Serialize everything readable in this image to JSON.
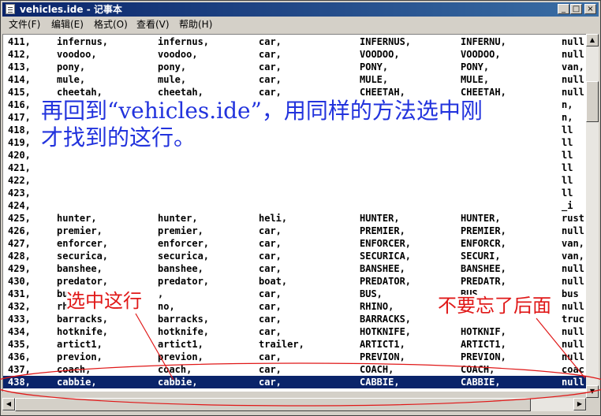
{
  "window": {
    "title": "vehicles.ide - 记事本",
    "controls": {
      "minimize": "_",
      "maximize": "□",
      "close": "×"
    }
  },
  "menu": [
    "文件(F)",
    "编辑(E)",
    "格式(O)",
    "查看(V)",
    "帮助(H)"
  ],
  "rows": [
    {
      "id": "411,",
      "c1": "infernus,",
      "c2": "infernus,",
      "c3": "car,",
      "c4": "INFERNUS,",
      "c5": "INFERNU,",
      "c6": "null"
    },
    {
      "id": "412,",
      "c1": "voodoo,",
      "c2": "voodoo,",
      "c3": "car,",
      "c4": "VOODOO,",
      "c5": "VOODOO,",
      "c6": "null"
    },
    {
      "id": "413,",
      "c1": "pony,",
      "c2": "pony,",
      "c3": "car,",
      "c4": "PONY,",
      "c5": "PONY,",
      "c6": "van,"
    },
    {
      "id": "414,",
      "c1": "mule,",
      "c2": "mule,",
      "c3": "car,",
      "c4": "MULE,",
      "c5": "MULE,",
      "c6": "null"
    },
    {
      "id": "415,",
      "c1": "cheetah,",
      "c2": "cheetah,",
      "c3": "car,",
      "c4": "CHEETAH,",
      "c5": "CHEETAH,",
      "c6": "null"
    },
    {
      "id": "416,",
      "c1": "",
      "c2": "",
      "c3": "",
      "c4": "",
      "c5": "",
      "c6": "n,"
    },
    {
      "id": "417,",
      "c1": "",
      "c2": "",
      "c3": "",
      "c4": "",
      "c5": "",
      "c6": "n,"
    },
    {
      "id": "418,",
      "c1": "",
      "c2": "",
      "c3": "",
      "c4": "",
      "c5": "",
      "c6": "ll"
    },
    {
      "id": "419,",
      "c1": "",
      "c2": "",
      "c3": "",
      "c4": "",
      "c5": "",
      "c6": "ll"
    },
    {
      "id": "420,",
      "c1": "",
      "c2": "",
      "c3": "",
      "c4": "",
      "c5": "",
      "c6": "ll"
    },
    {
      "id": "421,",
      "c1": "",
      "c2": "",
      "c3": "",
      "c4": "",
      "c5": "",
      "c6": "ll"
    },
    {
      "id": "422,",
      "c1": "",
      "c2": "",
      "c3": "",
      "c4": "",
      "c5": "",
      "c6": "ll"
    },
    {
      "id": "423,",
      "c1": "",
      "c2": "",
      "c3": "",
      "c4": "",
      "c5": "",
      "c6": "ll"
    },
    {
      "id": "424,",
      "c1": "",
      "c2": "",
      "c3": "",
      "c4": "",
      "c5": "",
      "c6": "_i"
    },
    {
      "id": "425,",
      "c1": "hunter,",
      "c2": "hunter,",
      "c3": "heli,",
      "c4": "HUNTER,",
      "c5": "HUNTER,",
      "c6": "rust"
    },
    {
      "id": "426,",
      "c1": "premier,",
      "c2": "premier,",
      "c3": "car,",
      "c4": "PREMIER,",
      "c5": "PREMIER,",
      "c6": "null"
    },
    {
      "id": "427,",
      "c1": "enforcer,",
      "c2": "enforcer,",
      "c3": "car,",
      "c4": "ENFORCER,",
      "c5": "ENFORCR,",
      "c6": "van,"
    },
    {
      "id": "428,",
      "c1": "securica,",
      "c2": "securica,",
      "c3": "car,",
      "c4": "SECURICA,",
      "c5": "SECURI,",
      "c6": "van,"
    },
    {
      "id": "429,",
      "c1": "banshee,",
      "c2": "banshee,",
      "c3": "car,",
      "c4": "BANSHEE,",
      "c5": "BANSHEE,",
      "c6": "null"
    },
    {
      "id": "430,",
      "c1": "predator,",
      "c2": "predator,",
      "c3": "boat,",
      "c4": "PREDATOR,",
      "c5": "PREDATR,",
      "c6": "null"
    },
    {
      "id": "431,",
      "c1": "bu",
      "c2": ",",
      "c3": "car,",
      "c4": "BUS,",
      "c5": "BUS,",
      "c6": "bus"
    },
    {
      "id": "432,",
      "c1": "rh",
      "c2": "no,",
      "c3": "car,",
      "c4": "RHINO,",
      "c5": "",
      "c6": "null"
    },
    {
      "id": "433,",
      "c1": "barracks,",
      "c2": "barracks,",
      "c3": "car,",
      "c4": "BARRACKS,",
      "c5": "",
      "c6": "truc"
    },
    {
      "id": "434,",
      "c1": "hotknife,",
      "c2": "hotknife,",
      "c3": "car,",
      "c4": "HOTKNIFE,",
      "c5": "HOTKNIF,",
      "c6": "null"
    },
    {
      "id": "435,",
      "c1": "artict1,",
      "c2": "artict1,",
      "c3": "trailer,",
      "c4": "ARTICT1,",
      "c5": "ARTICT1,",
      "c6": "null"
    },
    {
      "id": "436,",
      "c1": "previon,",
      "c2": "previon,",
      "c3": "car,",
      "c4": "PREVION,",
      "c5": "PREVION,",
      "c6": "null"
    },
    {
      "id": "437,",
      "c1": "coach,",
      "c2": "coach,",
      "c3": "car,",
      "c4": "COACH,",
      "c5": "COACH,",
      "c6": "coac"
    },
    {
      "id": "438,",
      "c1": "cabbie,",
      "c2": "cabbie,",
      "c3": "car,",
      "c4": "CABBIE,",
      "c5": "CABBIE,",
      "c6": "null",
      "selected": true
    }
  ],
  "annotations": {
    "main": [
      "再回到“vehicles.ide”，用同样的方法选中刚",
      "才找到的这行。"
    ],
    "select_row": "选中这行",
    "dont_forget": "不要忘了后面"
  },
  "colors": {
    "title_start": "#0a246a",
    "title_end": "#3a6ea5",
    "selection": "#0a246a",
    "annotation_blue": "#2233dd",
    "annotation_red": "#e01818"
  }
}
